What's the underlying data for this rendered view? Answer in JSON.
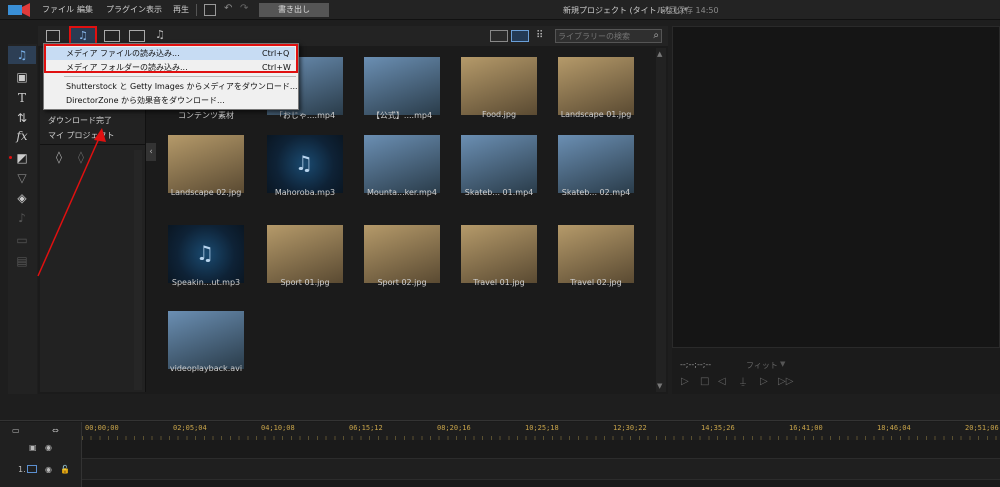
{
  "menu": {
    "file": "ファイル",
    "edit": "編集",
    "plugin": "プラグイン",
    "view": "表示",
    "play": "再生"
  },
  "toolbar": {
    "export_label": "書き出し"
  },
  "window": {
    "project_title": "新規プロジェクト (タイトルなし)*",
    "autosave": "前回保存 14:50"
  },
  "search": {
    "placeholder": "ライブラリーの検索"
  },
  "tree": {
    "items": [
      "ダウンロード完了",
      "マイ プロジェクト"
    ]
  },
  "dropdown": {
    "items": [
      {
        "label": "メディア ファイルの読み込み...",
        "shortcut": "Ctrl+Q"
      },
      {
        "label": "メディア フォルダーの読み込み...",
        "shortcut": "Ctrl+W"
      },
      {
        "label": "Shutterstock と Getty Images からメディアをダウンロード...",
        "shortcut": ""
      },
      {
        "label": "DirectorZone から効果音をダウンロード...",
        "shortcut": ""
      }
    ]
  },
  "media": {
    "items": [
      {
        "name": "コンテンツ素材",
        "kind": "folder"
      },
      {
        "name": "「おじゃ....mp4",
        "kind": "video"
      },
      {
        "name": "【公式】....mp4",
        "kind": "video"
      },
      {
        "name": "Food.jpg",
        "kind": "image"
      },
      {
        "name": "Landscape 01.jpg",
        "kind": "image"
      },
      {
        "name": "Landscape 02.jpg",
        "kind": "image"
      },
      {
        "name": "Mahoroba.mp3",
        "kind": "audio"
      },
      {
        "name": "Mounta...ker.mp4",
        "kind": "video"
      },
      {
        "name": "Skateb... 01.mp4",
        "kind": "video"
      },
      {
        "name": "Skateb... 02.mp4",
        "kind": "video"
      },
      {
        "name": "Speakin...ut.mp3",
        "kind": "audio"
      },
      {
        "name": "Sport 01.jpg",
        "kind": "image"
      },
      {
        "name": "Sport 02.jpg",
        "kind": "image"
      },
      {
        "name": "Travel 01.jpg",
        "kind": "image"
      },
      {
        "name": "Travel 02.jpg",
        "kind": "image"
      },
      {
        "name": "videoplayback.avi",
        "kind": "video"
      }
    ]
  },
  "preview": {
    "timecode": "--;--;--;--",
    "fit": "フィット"
  },
  "timeline": {
    "ruler": [
      "00;00;00",
      "02;05;04",
      "04;10;08",
      "06;15;12",
      "08;20;16",
      "10;25;18",
      "12;30;22",
      "14;35;26",
      "16;41;00",
      "18;46;04",
      "20;51;06"
    ],
    "track_label": "1."
  },
  "colors": {
    "highlight": "#e01010",
    "accent": "#6a9fd8",
    "ruler_text": "#c8a44a"
  }
}
